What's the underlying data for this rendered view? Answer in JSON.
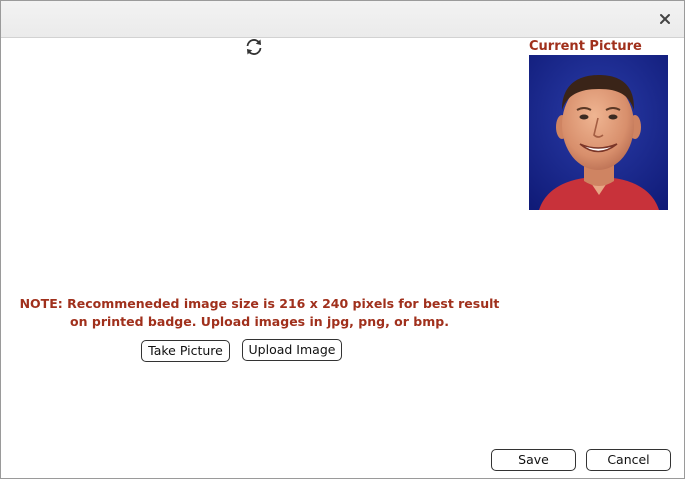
{
  "dialog": {
    "close_icon": "close-icon",
    "refresh_icon": "refresh-icon",
    "current_picture_label": "Current Picture",
    "note_line1": "NOTE: Recommeneded image size is 216 x 240 pixels for best result",
    "note_line2": "on printed badge. Upload images in jpg, png, or bmp.",
    "take_picture_label": "Take Picture",
    "upload_image_label": "Upload Image",
    "save_label": "Save",
    "cancel_label": "Cancel"
  },
  "colors": {
    "accent_text": "#a0301c",
    "photo_background": "#1a2a8c"
  }
}
